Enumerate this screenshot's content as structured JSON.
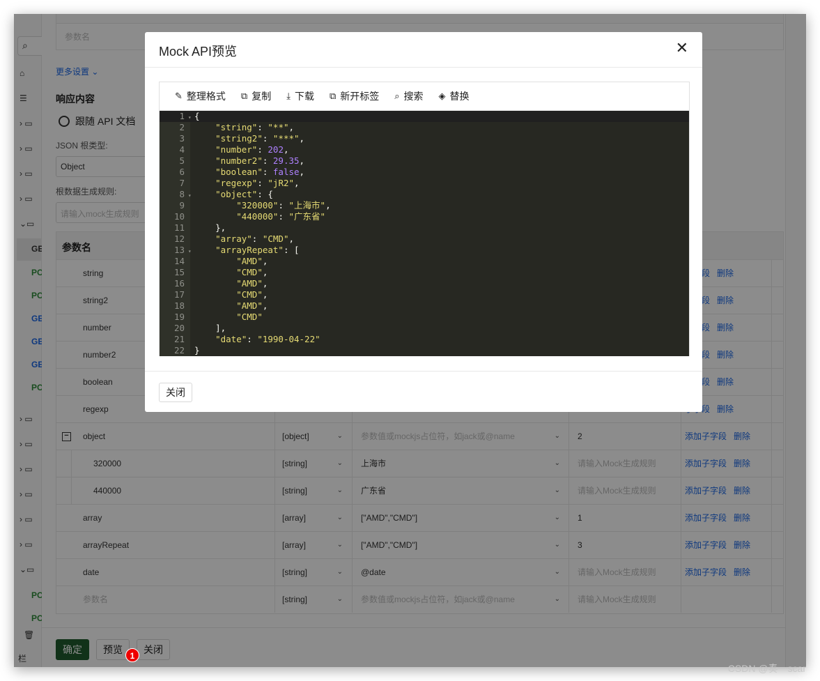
{
  "sidebar": {
    "footer_label": "栏",
    "methods": [
      "GE",
      "PO",
      "PO",
      "GE",
      "GE",
      "GE",
      "PO",
      "PO",
      "PO"
    ]
  },
  "panel": {
    "top_param_placeholder": "参数名",
    "more_settings": "更多设置",
    "response_title": "响应内容",
    "follow_api_doc": "跟随 API 文档",
    "json_root_type_label": "JSON 根类型:",
    "json_root_type_value": "Object",
    "root_rule_label": "根数据生成规则:",
    "root_rule_placeholder": "请输入mock生成规则",
    "grid_header": "参数名",
    "rows": [
      {
        "name": "string",
        "type": "",
        "value": "",
        "rule": "",
        "add": "子字段",
        "del": "删除",
        "child": false,
        "collapsible": false
      },
      {
        "name": "string2",
        "type": "",
        "value": "",
        "rule": "",
        "add": "子字段",
        "del": "删除",
        "child": false,
        "collapsible": false
      },
      {
        "name": "number",
        "type": "",
        "value": "",
        "rule": "",
        "add": "子字段",
        "del": "删除",
        "child": false,
        "collapsible": false
      },
      {
        "name": "number2",
        "type": "",
        "value": "",
        "rule": "",
        "add": "子字段",
        "del": "删除",
        "child": false,
        "collapsible": false
      },
      {
        "name": "boolean",
        "type": "",
        "value": "",
        "rule": "",
        "add": "子字段",
        "del": "删除",
        "child": false,
        "collapsible": false
      },
      {
        "name": "regexp",
        "type": "",
        "value": "",
        "rule": "",
        "add": "子字段",
        "del": "删除",
        "child": false,
        "collapsible": false
      },
      {
        "name": "object",
        "type": "[object]",
        "value": "参数值或mockjs占位符，如jack或@name",
        "value_ph": true,
        "rule": "2",
        "add": "添加子字段",
        "del": "删除",
        "child": false,
        "collapsible": true
      },
      {
        "name": "320000",
        "type": "[string]",
        "value": "上海市",
        "rule": "请输入Mock生成规则",
        "rule_ph": true,
        "add": "添加子字段",
        "del": "删除",
        "child": true,
        "collapsible": false
      },
      {
        "name": "440000",
        "type": "[string]",
        "value": "广东省",
        "rule": "请输入Mock生成规则",
        "rule_ph": true,
        "add": "添加子字段",
        "del": "删除",
        "child": true,
        "collapsible": false
      },
      {
        "name": "array",
        "type": "[array]",
        "value": "[\"AMD\",\"CMD\"]",
        "rule": "1",
        "add": "添加子字段",
        "del": "删除",
        "child": false,
        "collapsible": false
      },
      {
        "name": "arrayRepeat",
        "type": "[array]",
        "value": "[\"AMD\",\"CMD\"]",
        "rule": "3",
        "add": "添加子字段",
        "del": "删除",
        "child": false,
        "collapsible": false
      },
      {
        "name": "date",
        "type": "[string]",
        "value": "@date",
        "rule": "请输入Mock生成规则",
        "rule_ph": true,
        "add": "添加子字段",
        "del": "删除",
        "child": false,
        "collapsible": false
      },
      {
        "name": "参数名",
        "name_ph": true,
        "type": "[string]",
        "value": "参数值或mockjs占位符，如jack或@name",
        "value_ph": true,
        "rule": "请输入Mock生成规则",
        "rule_ph": true,
        "add": "",
        "del": "",
        "child": false,
        "collapsible": false
      }
    ],
    "buttons": {
      "confirm": "确定",
      "preview": "预览",
      "close": "关闭"
    },
    "badge": "1"
  },
  "modal": {
    "title": "Mock API预览",
    "toolbar": [
      {
        "icon": "format-icon",
        "label": "整理格式",
        "glyph": "✎"
      },
      {
        "icon": "copy-icon",
        "label": "复制",
        "glyph": "⧉"
      },
      {
        "icon": "download-icon",
        "label": "下载",
        "glyph": "⤓"
      },
      {
        "icon": "open-tab-icon",
        "label": "新开标签",
        "glyph": "⧉"
      },
      {
        "icon": "search-icon",
        "label": "搜索",
        "glyph": "⌕"
      },
      {
        "icon": "replace-icon",
        "label": "替换",
        "glyph": "◈"
      }
    ],
    "code_lines": [
      [
        [
          "p",
          "{"
        ]
      ],
      [
        [
          "p",
          "    "
        ],
        [
          "k",
          "\"string\""
        ],
        [
          "p",
          ": "
        ],
        [
          "s",
          "\"**\""
        ],
        [
          "p",
          ","
        ]
      ],
      [
        [
          "p",
          "    "
        ],
        [
          "k",
          "\"string2\""
        ],
        [
          "p",
          ": "
        ],
        [
          "s",
          "\"***\""
        ],
        [
          "p",
          ","
        ]
      ],
      [
        [
          "p",
          "    "
        ],
        [
          "k",
          "\"number\""
        ],
        [
          "p",
          ": "
        ],
        [
          "n",
          "202"
        ],
        [
          "p",
          ","
        ]
      ],
      [
        [
          "p",
          "    "
        ],
        [
          "k",
          "\"number2\""
        ],
        [
          "p",
          ": "
        ],
        [
          "n",
          "29.35"
        ],
        [
          "p",
          ","
        ]
      ],
      [
        [
          "p",
          "    "
        ],
        [
          "k",
          "\"boolean\""
        ],
        [
          "p",
          ": "
        ],
        [
          "b",
          "false"
        ],
        [
          "p",
          ","
        ]
      ],
      [
        [
          "p",
          "    "
        ],
        [
          "k",
          "\"regexp\""
        ],
        [
          "p",
          ": "
        ],
        [
          "s",
          "\"jR2\""
        ],
        [
          "p",
          ","
        ]
      ],
      [
        [
          "p",
          "    "
        ],
        [
          "k",
          "\"object\""
        ],
        [
          "p",
          ": {"
        ]
      ],
      [
        [
          "p",
          "        "
        ],
        [
          "k",
          "\"320000\""
        ],
        [
          "p",
          ": "
        ],
        [
          "s",
          "\"上海市\""
        ],
        [
          "p",
          ","
        ]
      ],
      [
        [
          "p",
          "        "
        ],
        [
          "k",
          "\"440000\""
        ],
        [
          "p",
          ": "
        ],
        [
          "s",
          "\"广东省\""
        ]
      ],
      [
        [
          "p",
          "    },"
        ]
      ],
      [
        [
          "p",
          "    "
        ],
        [
          "k",
          "\"array\""
        ],
        [
          "p",
          ": "
        ],
        [
          "s",
          "\"CMD\""
        ],
        [
          "p",
          ","
        ]
      ],
      [
        [
          "p",
          "    "
        ],
        [
          "k",
          "\"arrayRepeat\""
        ],
        [
          "p",
          ": ["
        ]
      ],
      [
        [
          "p",
          "        "
        ],
        [
          "s",
          "\"AMD\""
        ],
        [
          "p",
          ","
        ]
      ],
      [
        [
          "p",
          "        "
        ],
        [
          "s",
          "\"CMD\""
        ],
        [
          "p",
          ","
        ]
      ],
      [
        [
          "p",
          "        "
        ],
        [
          "s",
          "\"AMD\""
        ],
        [
          "p",
          ","
        ]
      ],
      [
        [
          "p",
          "        "
        ],
        [
          "s",
          "\"CMD\""
        ],
        [
          "p",
          ","
        ]
      ],
      [
        [
          "p",
          "        "
        ],
        [
          "s",
          "\"AMD\""
        ],
        [
          "p",
          ","
        ]
      ],
      [
        [
          "p",
          "        "
        ],
        [
          "s",
          "\"CMD\""
        ]
      ],
      [
        [
          "p",
          "    ],"
        ]
      ],
      [
        [
          "p",
          "    "
        ],
        [
          "k",
          "\"date\""
        ],
        [
          "p",
          ": "
        ],
        [
          "s",
          "\"1990-04-22\""
        ]
      ],
      [
        [
          "p",
          "}"
        ]
      ]
    ],
    "fold_lines": [
      1,
      8,
      13
    ],
    "close_button": "关闭"
  },
  "watermark": "CSDN @奏一scar"
}
